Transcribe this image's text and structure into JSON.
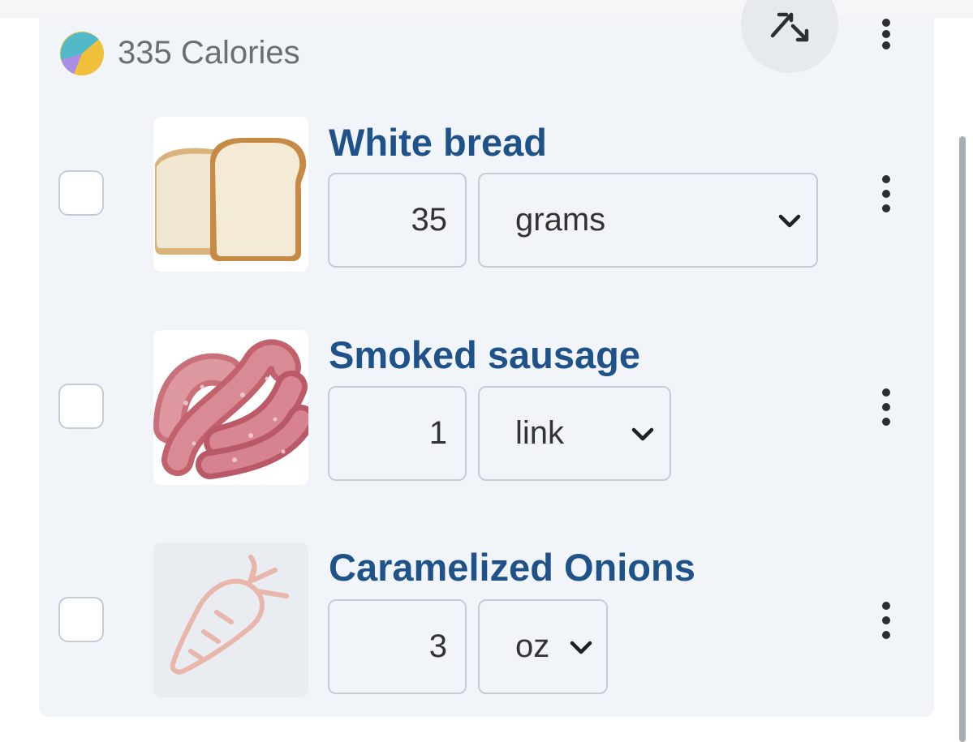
{
  "summary": {
    "calories_label": "335 Calories",
    "macro_colors": {
      "teal": "#52b9c9",
      "yellow": "#f0c03a",
      "purple": "#a98ee8"
    },
    "collapse_icon": "arrows-collapse-icon",
    "menu_icon": "kebab-menu-icon"
  },
  "foods": [
    {
      "name": "White bread",
      "quantity": "35",
      "unit": "grams",
      "image": "white-bread-image"
    },
    {
      "name": "Smoked sausage",
      "quantity": "1",
      "unit": "link",
      "image": "smoked-sausage-image"
    },
    {
      "name": "Caramelized Onions",
      "quantity": "3",
      "unit": "oz",
      "image": "carrot-placeholder-icon"
    }
  ],
  "colors": {
    "food_name": "#1f5288",
    "card_background": "#f1f5fa",
    "field_border": "#c3cdd8",
    "placeholder_icon": "#e8b6aa"
  }
}
